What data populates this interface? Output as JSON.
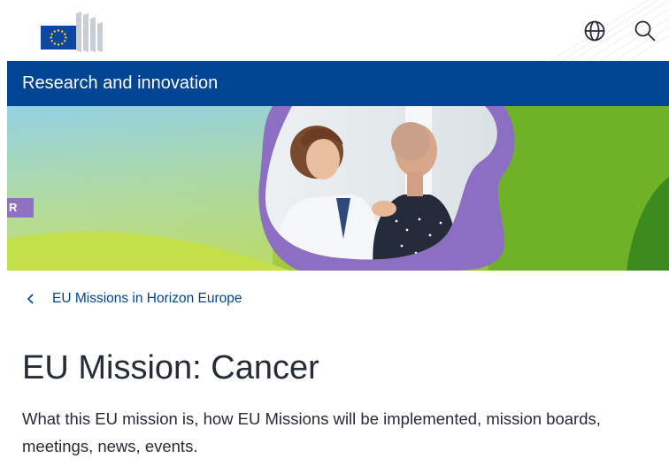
{
  "header": {
    "logo_icon": "european-commission-logo",
    "language_icon": "globe-icon",
    "search_icon": "search-icon"
  },
  "site": {
    "title": "Research and innovation",
    "bar_color": "#004494"
  },
  "hero": {
    "tag": "R",
    "image": "doctor-with-cancer-patient-photo"
  },
  "breadcrumb": {
    "back_icon": "chevron-left-icon",
    "link": "EU Missions in Horizon Europe"
  },
  "page": {
    "title": "EU Mission: Cancer",
    "description": "What this EU mission is, how EU Missions will be implemented, mission boards, meetings, news, events."
  }
}
